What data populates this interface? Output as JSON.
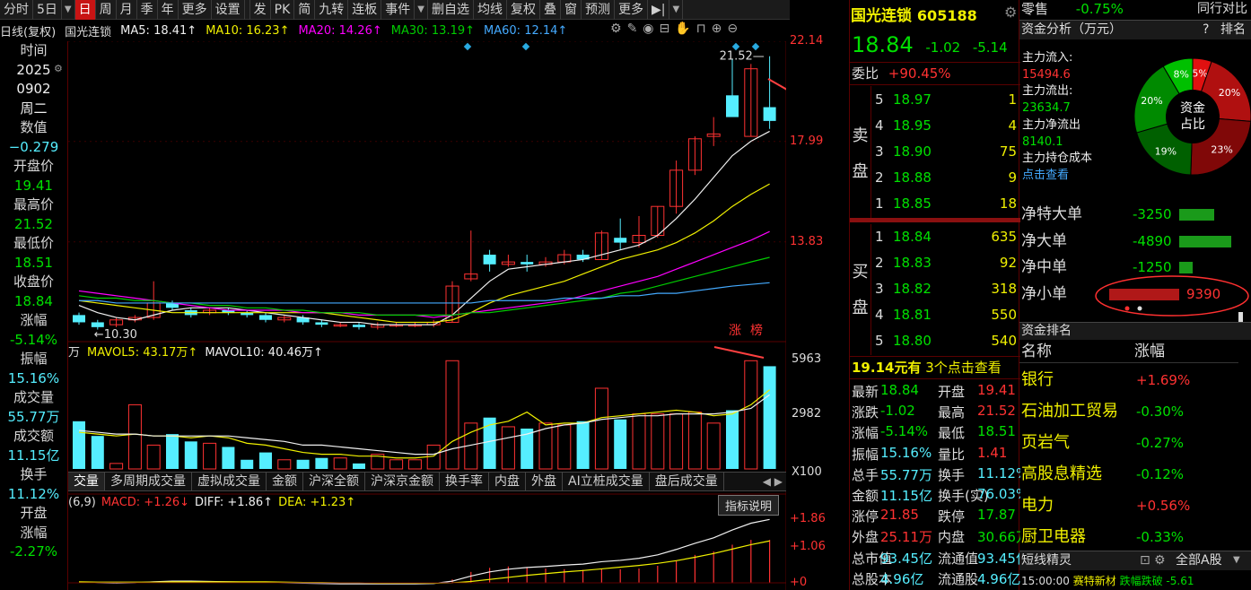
{
  "toolbar": {
    "items": [
      "分时",
      "5日",
      "▼",
      "日",
      "周",
      "月",
      "季",
      "年",
      "更多",
      "设置",
      "发",
      "PK",
      "简",
      "九转",
      "连板",
      "事件",
      "▼",
      "删自选",
      "均线",
      "复权",
      "叠",
      "窗",
      "预测",
      "更多",
      "▶|",
      "▼"
    ],
    "active_index": 3
  },
  "ma_bar": {
    "mode": "日线(复权)",
    "name": "国光连锁",
    "ma5": "MA5: 18.41↑",
    "ma10": "MA10: 16.23↑",
    "ma20": "MA20: 14.26↑",
    "ma30": "MA30: 13.19↑",
    "ma60": "MA60: 12.14↑"
  },
  "left_panel": [
    {
      "text": "时间",
      "cls": "lbl"
    },
    {
      "text": "2025",
      "cls": "white"
    },
    {
      "text": "0902",
      "cls": "white"
    },
    {
      "text": "周二",
      "cls": "white"
    },
    {
      "text": "数值",
      "cls": "lbl"
    },
    {
      "text": "−0.279",
      "cls": "cyan"
    },
    {
      "text": "开盘价",
      "cls": "lbl"
    },
    {
      "text": "19.41",
      "cls": "green"
    },
    {
      "text": "最高价",
      "cls": "lbl"
    },
    {
      "text": "21.52",
      "cls": "green"
    },
    {
      "text": "最低价",
      "cls": "lbl"
    },
    {
      "text": "18.51",
      "cls": "green"
    },
    {
      "text": "收盘价",
      "cls": "lbl"
    },
    {
      "text": "18.84",
      "cls": "green"
    },
    {
      "text": "涨幅",
      "cls": "lbl"
    },
    {
      "text": "-5.14%",
      "cls": "green"
    },
    {
      "text": "振幅",
      "cls": "lbl"
    },
    {
      "text": "15.16%",
      "cls": "cyan"
    },
    {
      "text": "成交量",
      "cls": "lbl"
    },
    {
      "text": "55.77万",
      "cls": "cyan"
    },
    {
      "text": "成交额",
      "cls": "lbl"
    },
    {
      "text": "11.15亿",
      "cls": "cyan"
    },
    {
      "text": "换手",
      "cls": "lbl"
    },
    {
      "text": "11.12%",
      "cls": "cyan"
    },
    {
      "text": "开盘",
      "cls": "lbl"
    },
    {
      "text": "涨幅",
      "cls": "lbl"
    },
    {
      "text": "-2.27%",
      "cls": "green"
    }
  ],
  "price_axis": [
    "22.14",
    "17.99",
    "13.83"
  ],
  "annotations": {
    "high": "21.52",
    "low": "10.30",
    "tag1": "涨",
    "tag2": "榜"
  },
  "vol_bar": {
    "unit": "万",
    "mavol5": "MAVOL5: 43.17万↑",
    "mavol10": "MAVOL10: 40.46万↑"
  },
  "vol_axis": [
    "5963",
    "2982",
    "X100"
  ],
  "tabs": [
    "交量",
    "多周期成交量",
    "虚拟成交量",
    "金额",
    "沪深全额",
    "沪深京金额",
    "换手率",
    "内盘",
    "外盘",
    "AI立桩成交量",
    "盘后成交量"
  ],
  "macd": {
    "params": "(6,9)",
    "macd": "MACD: +1.26↓",
    "diff": "DIFF: +1.86↑",
    "dea": "DEA: +1.23↑",
    "button": "指标说明"
  },
  "macd_axis": [
    "+1.86",
    "+1.06",
    "+0"
  ],
  "chart_data": {
    "type": "candlestick",
    "candles": [
      [
        10.8,
        10.9,
        10.4,
        10.5
      ],
      [
        10.5,
        10.6,
        10.2,
        10.3
      ],
      [
        10.4,
        10.7,
        10.3,
        10.6
      ],
      [
        10.6,
        10.8,
        10.5,
        10.7
      ],
      [
        10.7,
        12.2,
        10.6,
        11.3
      ],
      [
        11.3,
        11.4,
        11.0,
        11.1
      ],
      [
        11.0,
        11.1,
        10.7,
        10.8
      ],
      [
        10.9,
        11.1,
        10.8,
        11.0
      ],
      [
        11.0,
        11.1,
        10.8,
        10.9
      ],
      [
        10.9,
        11.0,
        10.7,
        10.8
      ],
      [
        10.8,
        10.9,
        10.5,
        10.6
      ],
      [
        10.6,
        10.8,
        10.5,
        10.7
      ],
      [
        10.7,
        10.8,
        10.4,
        10.5
      ],
      [
        10.5,
        10.6,
        10.3,
        10.4
      ],
      [
        10.4,
        10.5,
        10.3,
        10.4
      ],
      [
        10.4,
        10.5,
        10.2,
        10.3
      ],
      [
        10.3,
        10.5,
        10.2,
        10.4
      ],
      [
        10.4,
        10.5,
        10.3,
        10.4
      ],
      [
        10.4,
        10.5,
        10.3,
        10.4
      ],
      [
        10.4,
        10.6,
        10.3,
        10.5
      ],
      [
        10.5,
        12.2,
        10.5,
        12.0
      ],
      [
        12.3,
        14.3,
        12.2,
        12.5
      ],
      [
        13.3,
        13.5,
        12.6,
        12.9
      ],
      [
        12.9,
        13.3,
        12.8,
        13.0
      ],
      [
        13.0,
        13.3,
        12.6,
        12.9
      ],
      [
        12.9,
        13.2,
        12.8,
        13.0
      ],
      [
        13.0,
        13.5,
        12.9,
        13.3
      ],
      [
        13.3,
        13.5,
        13.0,
        13.1
      ],
      [
        13.1,
        14.3,
        13.1,
        14.2
      ],
      [
        14.0,
        14.8,
        13.5,
        13.8
      ],
      [
        13.8,
        14.9,
        13.6,
        14.1
      ],
      [
        14.1,
        15.3,
        14.0,
        15.3
      ],
      [
        15.3,
        17.2,
        15.0,
        16.8
      ],
      [
        16.8,
        18.2,
        16.6,
        18.1
      ],
      [
        18.2,
        19.0,
        17.8,
        18.3
      ],
      [
        19.9,
        21.4,
        19.5,
        19.0
      ],
      [
        18.2,
        21.2,
        18.2,
        21.0
      ],
      [
        19.41,
        21.52,
        18.51,
        18.84
      ]
    ],
    "ma5": [
      11.2,
      10.9,
      10.7,
      10.6,
      10.8,
      11.0,
      11.1,
      11.1,
      11.1,
      11.0,
      10.9,
      10.8,
      10.7,
      10.6,
      10.5,
      10.5,
      10.4,
      10.4,
      10.4,
      10.4,
      10.8,
      11.5,
      12.2,
      12.7,
      12.8,
      12.9,
      13.0,
      13.1,
      13.3,
      13.5,
      13.7,
      14.1,
      14.8,
      15.6,
      16.5,
      17.4,
      18.0,
      18.41
    ],
    "ma10": [
      11.4,
      11.3,
      11.2,
      11.1,
      11.0,
      10.9,
      10.9,
      10.9,
      10.9,
      10.9,
      10.9,
      10.9,
      10.9,
      10.9,
      10.8,
      10.7,
      10.6,
      10.5,
      10.5,
      10.5,
      10.6,
      10.9,
      11.3,
      11.6,
      11.8,
      12.0,
      12.2,
      12.5,
      12.8,
      13.1,
      13.3,
      13.5,
      13.8,
      14.2,
      14.7,
      15.3,
      15.8,
      16.23
    ],
    "ma20": [
      11.8,
      11.7,
      11.6,
      11.5,
      11.4,
      11.3,
      11.2,
      11.1,
      11.0,
      11.0,
      11.0,
      11.0,
      10.9,
      10.9,
      10.9,
      10.8,
      10.8,
      10.8,
      10.8,
      10.7,
      10.8,
      10.9,
      11.0,
      11.1,
      11.2,
      11.3,
      11.4,
      11.6,
      11.8,
      12.0,
      12.2,
      12.4,
      12.7,
      13.0,
      13.3,
      13.6,
      13.9,
      14.26
    ],
    "ma30": [
      11.6,
      11.5,
      11.5,
      11.4,
      11.4,
      11.3,
      11.3,
      11.2,
      11.2,
      11.1,
      11.1,
      11.0,
      11.0,
      10.9,
      10.9,
      10.9,
      10.8,
      10.8,
      10.8,
      10.8,
      10.8,
      10.9,
      10.9,
      11.0,
      11.1,
      11.2,
      11.3,
      11.4,
      11.5,
      11.7,
      11.8,
      12.0,
      12.2,
      12.4,
      12.6,
      12.8,
      13.0,
      13.19
    ],
    "ma60": [
      11.4,
      11.4,
      11.3,
      11.3,
      11.3,
      11.3,
      11.3,
      11.3,
      11.3,
      11.3,
      11.3,
      11.3,
      11.3,
      11.3,
      11.3,
      11.3,
      11.3,
      11.3,
      11.3,
      11.3,
      11.3,
      11.3,
      11.4,
      11.4,
      11.4,
      11.4,
      11.5,
      11.5,
      11.5,
      11.6,
      11.6,
      11.7,
      11.7,
      11.8,
      11.9,
      12.0,
      12.07,
      12.14
    ],
    "volume": [
      26,
      18,
      3,
      35,
      13,
      19,
      15,
      14,
      12,
      5,
      9,
      5,
      5,
      6,
      6,
      3,
      8,
      5,
      5,
      13,
      59,
      25,
      28,
      23,
      22,
      25,
      24,
      26,
      44,
      27,
      30,
      30,
      30,
      31,
      25,
      32,
      59,
      56
    ],
    "mavol5": [
      20,
      19,
      18,
      19,
      18,
      18,
      17,
      18,
      17,
      14,
      13,
      11,
      9,
      8,
      8,
      7,
      7,
      6,
      6,
      7,
      15,
      20,
      24,
      26,
      31,
      24,
      25,
      25,
      28,
      29,
      30,
      31,
      32,
      31,
      29,
      30,
      35,
      43.17
    ],
    "mavol10": [
      21,
      20,
      19,
      19,
      18,
      18,
      18,
      18,
      18,
      17,
      16,
      15,
      13,
      13,
      12,
      11,
      10,
      9,
      8,
      8,
      11,
      13,
      15,
      17,
      19,
      22,
      24,
      25,
      27,
      28,
      29,
      29,
      30,
      30,
      30,
      31,
      33,
      40.46
    ],
    "diff": [
      0.02,
      0.0,
      -0.01,
      0.0,
      0.03,
      0.05,
      0.05,
      0.04,
      0.03,
      0.02,
      0.01,
      0.0,
      -0.01,
      -0.02,
      -0.03,
      -0.03,
      -0.03,
      -0.03,
      -0.03,
      -0.02,
      0.05,
      0.2,
      0.32,
      0.4,
      0.45,
      0.48,
      0.52,
      0.55,
      0.62,
      0.66,
      0.72,
      0.82,
      0.98,
      1.16,
      1.32,
      1.55,
      1.75,
      1.86
    ],
    "dea": [
      0.03,
      0.02,
      0.02,
      0.02,
      0.02,
      0.03,
      0.03,
      0.03,
      0.03,
      0.03,
      0.03,
      0.02,
      0.01,
      0.01,
      0.0,
      0.0,
      -0.01,
      -0.01,
      -0.01,
      -0.01,
      0.0,
      0.04,
      0.1,
      0.16,
      0.22,
      0.27,
      0.32,
      0.36,
      0.41,
      0.46,
      0.51,
      0.57,
      0.65,
      0.75,
      0.86,
      0.99,
      1.12,
      1.23
    ],
    "ylim": [
      9.7,
      22.14
    ],
    "yticks": [
      22.14,
      17.99,
      13.83
    ]
  },
  "quote": {
    "name": "国光连锁",
    "code": "605188",
    "price": "18.84",
    "change": "-1.02",
    "pct": "-5.14",
    "weibi_label": "委比",
    "weibi": "+90.45%",
    "sell_label": [
      "卖",
      "盘"
    ],
    "buy_label": [
      "买",
      "盘"
    ],
    "sell": [
      [
        "5",
        "18.97",
        "1"
      ],
      [
        "4",
        "18.95",
        "4"
      ],
      [
        "3",
        "18.90",
        "75"
      ],
      [
        "2",
        "18.88",
        "9"
      ],
      [
        "1",
        "18.85",
        "18"
      ]
    ],
    "buy": [
      [
        "1",
        "18.84",
        "635"
      ],
      [
        "2",
        "18.83",
        "92"
      ],
      [
        "3",
        "18.82",
        "318"
      ],
      [
        "4",
        "18.81",
        "550"
      ],
      [
        "5",
        "18.80",
        "540"
      ]
    ],
    "promo_price": "19.14元有",
    "promo_text": "3个点击查看",
    "stats": [
      [
        "最新",
        "18.84",
        "开盘",
        "19.41"
      ],
      [
        "涨跌",
        "-1.02",
        "最高",
        "21.52"
      ],
      [
        "涨幅",
        "-5.14%",
        "最低",
        "18.51"
      ],
      [
        "振幅",
        "15.16%",
        "量比",
        "1.41"
      ],
      [
        "总手",
        "55.77万",
        "换手",
        "11.12%"
      ],
      [
        "金额",
        "11.15亿",
        "换手(实)",
        "76.03%"
      ],
      [
        "涨停",
        "21.85",
        "跌停",
        "17.87"
      ],
      [
        "外盘",
        "25.11万",
        "内盘",
        "30.66万"
      ],
      [
        "总市值",
        "93.45亿",
        "流通值",
        "93.45亿"
      ],
      [
        "总股本",
        "4.96亿",
        "流通股",
        "4.96亿"
      ]
    ]
  },
  "right": {
    "industry": "零售",
    "industry_pct": "-0.75%",
    "industry_rank": "同行对比",
    "flow_title": "资金分析（万元）",
    "flow_help": "?",
    "flow_rank": "排名",
    "inflow_label": "主力流入:",
    "inflow": "15494.6",
    "outflow_label": "主力流出:",
    "outflow": "23634.7",
    "net_label": "主力净流出",
    "net": "8140.1",
    "cost_label": "主力持仓成本",
    "cost_link": "点击查看",
    "pie_center": [
      "资金",
      "占比"
    ],
    "pie": [
      {
        "label": "5%",
        "value": 5,
        "color": "#e01010"
      },
      {
        "label": "20%",
        "value": 20,
        "color": "#b01010"
      },
      {
        "label": "23%",
        "value": 23,
        "color": "#800808"
      },
      {
        "label": "19%",
        "value": 19,
        "color": "#006000"
      },
      {
        "label": "20%",
        "value": 20,
        "color": "#008a00"
      },
      {
        "label": "8%",
        "value": 8,
        "color": "#00c000"
      }
    ],
    "orders": [
      {
        "name": "净特大单",
        "value": "-3250",
        "amount": -3250
      },
      {
        "name": "净大单",
        "value": "-4890",
        "amount": -4890
      },
      {
        "name": "净中单",
        "value": "-1250",
        "amount": -1250
      },
      {
        "name": "净小单",
        "value": "9390",
        "amount": 9390
      }
    ],
    "rank_title": "资金排名",
    "rank_head": [
      "名称",
      "涨幅"
    ],
    "rank_rows": [
      [
        "银行",
        "+1.69%"
      ],
      [
        "石油加工贸易",
        "-0.30%"
      ],
      [
        "页岩气",
        "-0.27%"
      ],
      [
        "高股息精选",
        "-0.12%"
      ],
      [
        "电力",
        "+0.56%"
      ],
      [
        "厨卫电器",
        "-0.33%"
      ]
    ],
    "spirit_title": "短线精灵",
    "spirit_filter": "全部A股",
    "spirit_time": "15:00:00",
    "spirit_stock": "赛特新材",
    "spirit_event": "跌幅跌破",
    "spirit_value": "-5.61"
  }
}
